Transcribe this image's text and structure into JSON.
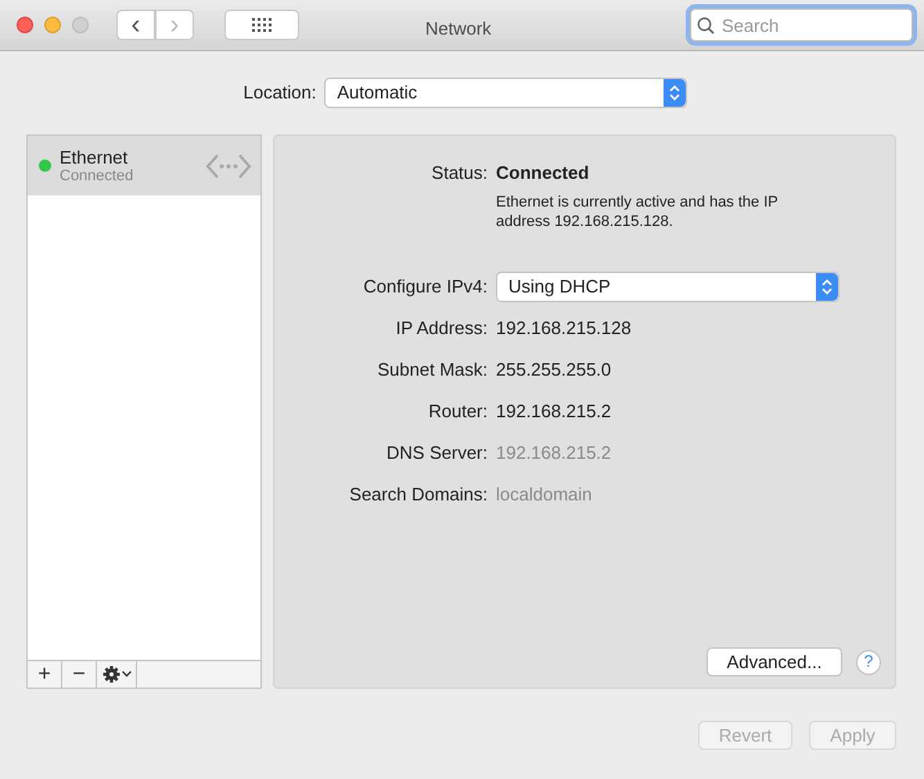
{
  "window": {
    "title": "Network",
    "buttons": [
      "‹",
      "›"
    ],
    "search": {
      "placeholder": "Search"
    }
  },
  "location": {
    "label": "Location:",
    "value": "Automatic"
  },
  "services": [
    {
      "name": "Ethernet",
      "status": "Connected",
      "color": "#34c84a",
      "selected": true
    }
  ],
  "sidebar_tools": [
    "+",
    "−"
  ],
  "status": {
    "label": "Status:",
    "value": "Connected",
    "description": "Ethernet is currently active and has the IP address 192.168.215.128."
  },
  "configure": {
    "label": "Configure IPv4:",
    "value": "Using DHCP"
  },
  "details": [
    {
      "label": "IP Address:",
      "value": "192.168.215.128",
      "disabled": false
    },
    {
      "label": "Subnet Mask:",
      "value": "255.255.255.0",
      "disabled": false
    },
    {
      "label": "Router:",
      "value": "192.168.215.2",
      "disabled": false
    },
    {
      "label": "DNS Server:",
      "value": "192.168.215.2",
      "disabled": true
    },
    {
      "label": "Search Domains:",
      "value": "localdomain",
      "disabled": true
    }
  ],
  "advanced_button": "Advanced...",
  "help_button": "?",
  "footer_buttons": [
    {
      "label": "Revert",
      "disabled": true
    },
    {
      "label": "Apply",
      "disabled": true
    }
  ]
}
